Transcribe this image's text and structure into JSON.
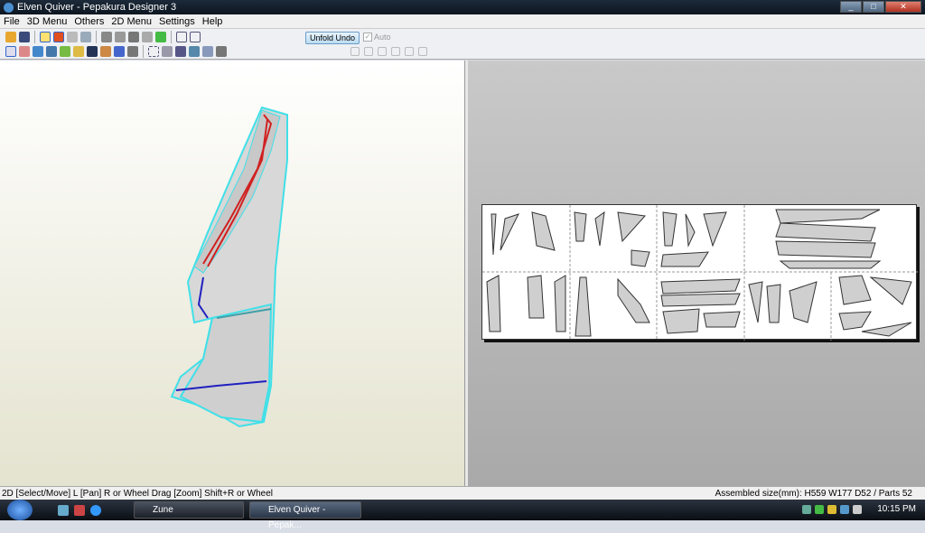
{
  "window": {
    "title": "Elven Quiver - Pepakura Designer 3"
  },
  "menu": [
    "File",
    "3D Menu",
    "Others",
    "2D Menu",
    "Settings",
    "Help"
  ],
  "toolbar": {
    "unfold_undo": "Unfold Undo",
    "auto_label": "Auto",
    "auto_checked": true
  },
  "status": {
    "left": "2D [Select/Move] L [Pan] R or Wheel Drag [Zoom] Shift+R or Wheel",
    "right": "Assembled size(mm): H559 W177 D52 / Parts 52"
  },
  "taskbar": {
    "tasks": [
      "Zune",
      "Elven Quiver - Pepak..."
    ],
    "clock": "10:15 PM"
  },
  "colors": {
    "model_fill": "#d8d8d8",
    "model_edge": "#40e0e8",
    "cut_red": "#d02020",
    "fold_blue": "#2020c0"
  }
}
